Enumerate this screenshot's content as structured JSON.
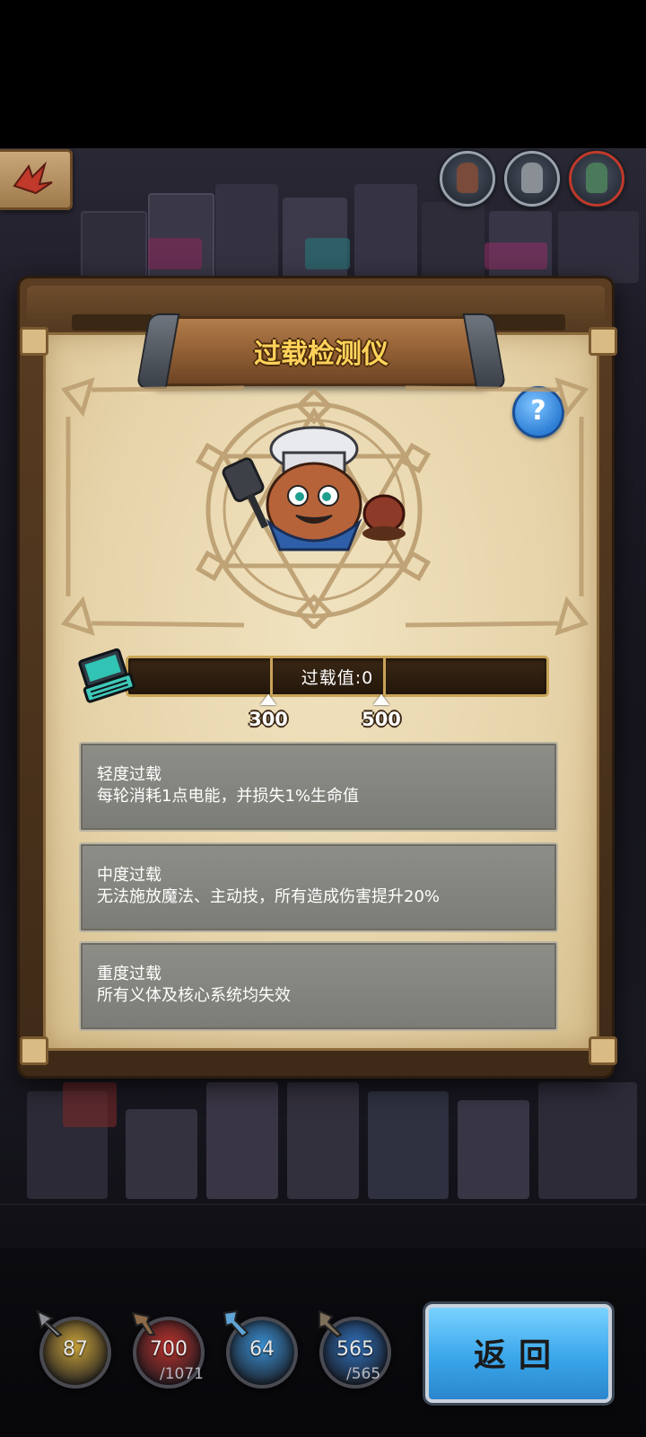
{
  "panel": {
    "title": "过载检测仪",
    "help_icon": "question-badge-icon",
    "overload": {
      "label": "过载值:0",
      "value": 0,
      "thresholds": [
        "300",
        "500"
      ]
    },
    "levels": [
      {
        "name": "轻度过载",
        "desc": "每轮消耗1点电能，并损失1%生命值"
      },
      {
        "name": "中度过载",
        "desc": "无法施放魔法、主动技，所有造成伤害提升20%"
      },
      {
        "name": "重度过载",
        "desc": "所有义体及核心系统均失效"
      }
    ]
  },
  "stats": [
    {
      "name": "attack",
      "value": "87",
      "max": "",
      "color": "#c9a23a",
      "icon": "attack-stat-icon"
    },
    {
      "name": "health",
      "value": "700",
      "max": "/1071",
      "color": "#b8322c",
      "icon": "health-stat-icon"
    },
    {
      "name": "magic",
      "value": "64",
      "max": "",
      "color": "#3a8fd1",
      "icon": "magic-stat-icon"
    },
    {
      "name": "energy",
      "value": "565",
      "max": "/565",
      "color": "#2f6fb8",
      "icon": "energy-stat-icon"
    }
  ],
  "return_button": {
    "label": "返回"
  },
  "colors": {
    "title": "#ffd35a",
    "paper": "#e6d3a9",
    "button": "#3aa6ea"
  }
}
